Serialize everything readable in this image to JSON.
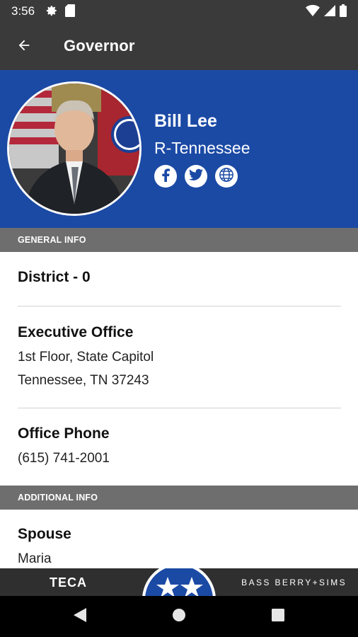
{
  "status_bar": {
    "time": "3:56",
    "left_icons": [
      "gear-icon",
      "sd-card-icon"
    ],
    "right_icons": [
      "wifi-icon",
      "signal-icon",
      "battery-icon"
    ]
  },
  "app_bar": {
    "title": "Governor",
    "back_icon": "arrow-left-icon"
  },
  "profile": {
    "name": "Bill Lee",
    "party_state": "R-Tennessee",
    "social": [
      "facebook-icon",
      "twitter-icon",
      "globe-icon"
    ],
    "hero_color": "#1b4aa5"
  },
  "general_info": {
    "header": "GENERAL INFO",
    "district": "District - 0",
    "office_label": "Executive Office",
    "office_line1": "1st Floor, State Capitol",
    "office_line2": "Tennessee, TN 37243",
    "phone_label": "Office Phone",
    "phone_value": "(615) 741-2001"
  },
  "additional_info": {
    "header": "ADDITIONAL INFO",
    "spouse_label": "Spouse",
    "spouse_value": "Maria"
  },
  "footer": {
    "left_logo": "TECA",
    "right_logo": "BASS BERRY+SIMS"
  },
  "nav_bar": [
    "back-triangle-icon",
    "home-circle-icon",
    "recents-square-icon"
  ]
}
